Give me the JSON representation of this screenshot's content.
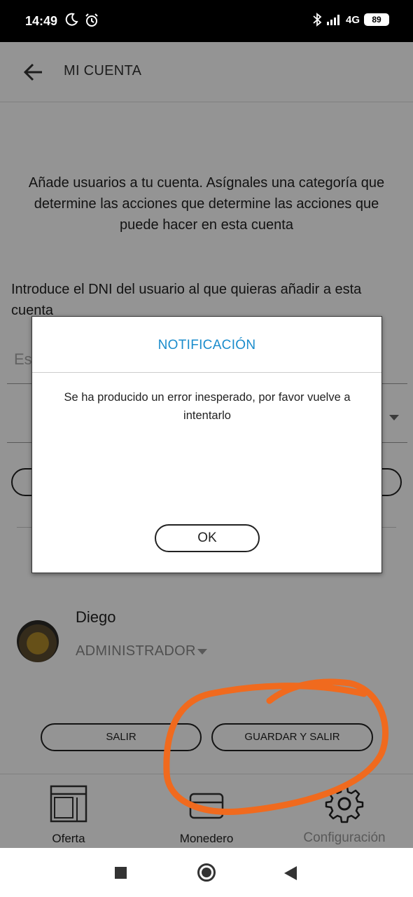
{
  "status_bar": {
    "time": "14:49",
    "network": "4G",
    "battery": "89",
    "icons": [
      "moon-icon",
      "alarm-icon",
      "bluetooth-icon",
      "signal-icon"
    ]
  },
  "header": {
    "title": "MI CUENTA",
    "back_icon": "arrow-left-icon"
  },
  "main": {
    "intro": "Añade usuarios a tu cuenta. Asígnales una categoría que determine las acciones que determine las acciones que puede hacer en esta cuenta",
    "dni_prompt": "Introduce el DNI del usuario al que quieras añadir a esta cuenta",
    "dni_placeholder": "Es"
  },
  "user": {
    "name": "Diego",
    "role": "ADMINISTRADOR"
  },
  "actions": {
    "exit_label": "SALIR",
    "save_exit_label": "GUARDAR Y SALIR"
  },
  "bottom_nav": [
    {
      "label": "Oferta",
      "icon": "storefront-icon"
    },
    {
      "label": "Monedero",
      "icon": "wallet-icon"
    },
    {
      "label": "Configuración",
      "icon": "gear-icon"
    }
  ],
  "dialog": {
    "title": "NOTIFICACIÓN",
    "message": "Se ha producido un error inesperado, por favor vuelve a intentarlo",
    "ok_label": "OK"
  },
  "colors": {
    "dialog_title": "#1a8ccc",
    "annotation_stroke": "#f06a1e"
  }
}
